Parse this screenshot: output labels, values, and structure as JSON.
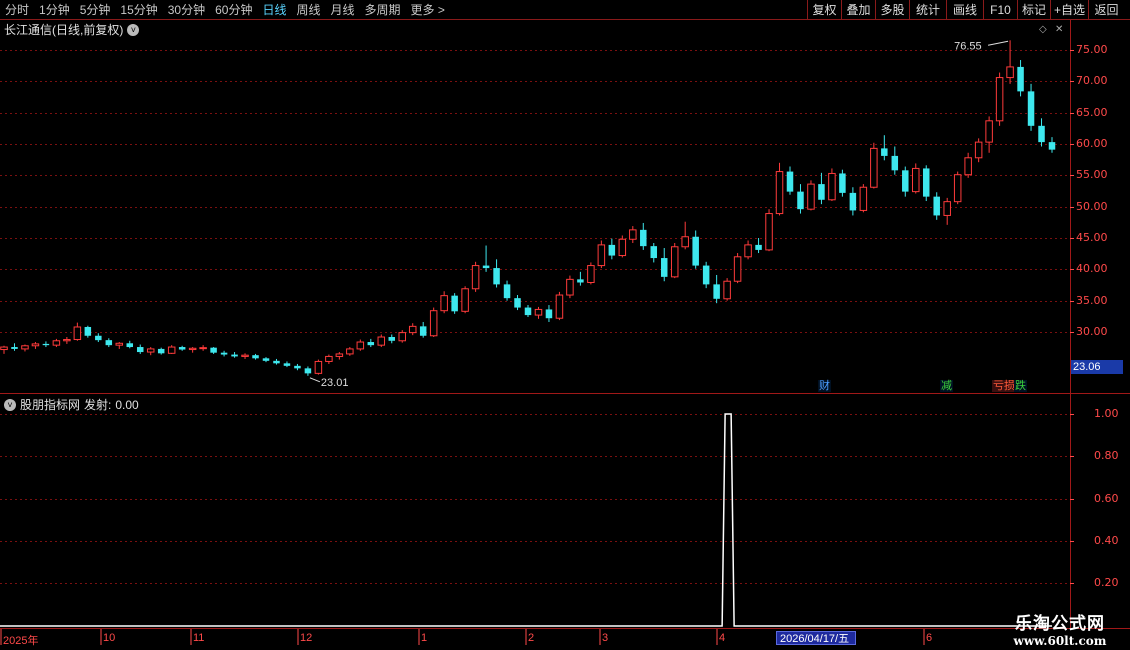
{
  "periods": [
    "分时",
    "1分钟",
    "5分钟",
    "15分钟",
    "30分钟",
    "60分钟",
    "日线",
    "周线",
    "月线",
    "多周期",
    "更多 >"
  ],
  "active_period": "日线",
  "tools": [
    "复权",
    "叠加",
    "多股",
    "统计",
    "画线",
    "F10",
    "标记",
    "+自选",
    "返回"
  ],
  "stock_title": "长江通信(日线,前复权)",
  "indicator_title": "股朋指标网",
  "indicator_signal_label": "发射:",
  "indicator_signal_value": "0.00",
  "price_axis": [
    "75.00",
    "70.00",
    "65.00",
    "60.00",
    "55.00",
    "50.00",
    "45.00",
    "40.00",
    "35.00",
    "30.00"
  ],
  "indicator_axis": [
    "1.00",
    "0.80",
    "0.60",
    "0.40",
    "0.20"
  ],
  "current_price": "23.06",
  "high_label": "76.55",
  "low_label": "23.01",
  "time_axis": [
    "2025年",
    "10",
    "11",
    "12",
    "1",
    "2",
    "3",
    "4",
    "2026/04/17/五",
    "6"
  ],
  "markers": [
    {
      "text": "财",
      "color": "#4a9cff"
    },
    {
      "text": "减",
      "color": "#3cd33c"
    },
    {
      "text": "亏损",
      "color": "#ff5a3a"
    },
    {
      "text": "跌",
      "color": "#3cd33c"
    }
  ],
  "watermark": {
    "line1": "乐淘公式网",
    "line2": "www.60lt.com"
  },
  "colors": {
    "up": "#ff3b3b",
    "down": "#3ee8ee",
    "grid": "#7a1010",
    "axis": "#ff4a4a",
    "signal": "#ffffff"
  },
  "chart_data": {
    "type": "candlestick",
    "ylim": [
      23,
      77
    ],
    "candles": [
      [
        27.2,
        27.8,
        26.5,
        27.6
      ],
      [
        27.6,
        28.2,
        27.0,
        27.3
      ],
      [
        27.3,
        28.0,
        26.9,
        27.8
      ],
      [
        27.8,
        28.4,
        27.3,
        28.1
      ],
      [
        28.1,
        28.5,
        27.6,
        27.9
      ],
      [
        27.9,
        28.9,
        27.6,
        28.6
      ],
      [
        28.6,
        29.2,
        28.1,
        28.8
      ],
      [
        28.8,
        31.5,
        28.6,
        30.8
      ],
      [
        30.8,
        31.0,
        29.1,
        29.4
      ],
      [
        29.4,
        29.8,
        28.4,
        28.7
      ],
      [
        28.7,
        29.0,
        27.6,
        27.9
      ],
      [
        27.9,
        28.4,
        27.3,
        28.2
      ],
      [
        28.2,
        28.6,
        27.4,
        27.6
      ],
      [
        27.6,
        28.0,
        26.5,
        26.8
      ],
      [
        26.8,
        27.6,
        26.3,
        27.3
      ],
      [
        27.3,
        27.5,
        26.4,
        26.6
      ],
      [
        26.6,
        27.9,
        26.5,
        27.6
      ],
      [
        27.6,
        27.8,
        27.0,
        27.2
      ],
      [
        27.2,
        27.6,
        26.7,
        27.4
      ],
      [
        27.4,
        27.9,
        27.0,
        27.5
      ],
      [
        27.5,
        27.6,
        26.5,
        26.7
      ],
      [
        26.7,
        27.0,
        26.1,
        26.4
      ],
      [
        26.4,
        26.8,
        25.9,
        26.1
      ],
      [
        26.1,
        26.6,
        25.7,
        26.3
      ],
      [
        26.3,
        26.5,
        25.6,
        25.8
      ],
      [
        25.8,
        26.0,
        25.2,
        25.4
      ],
      [
        25.4,
        25.7,
        24.8,
        25.0
      ],
      [
        25.0,
        25.3,
        24.4,
        24.6
      ],
      [
        24.6,
        24.9,
        23.9,
        24.2
      ],
      [
        24.2,
        24.5,
        23.01,
        23.4
      ],
      [
        23.4,
        25.6,
        23.2,
        25.3
      ],
      [
        25.3,
        26.4,
        24.9,
        26.1
      ],
      [
        26.1,
        26.8,
        25.6,
        26.5
      ],
      [
        26.5,
        27.6,
        26.2,
        27.3
      ],
      [
        27.3,
        28.8,
        27.0,
        28.4
      ],
      [
        28.4,
        28.9,
        27.6,
        27.9
      ],
      [
        27.9,
        29.6,
        27.6,
        29.2
      ],
      [
        29.2,
        29.6,
        28.2,
        28.6
      ],
      [
        28.6,
        30.3,
        28.3,
        29.9
      ],
      [
        29.9,
        31.4,
        29.5,
        30.9
      ],
      [
        30.9,
        31.6,
        29.1,
        29.4
      ],
      [
        29.4,
        33.9,
        29.2,
        33.4
      ],
      [
        33.4,
        36.5,
        33.0,
        35.8
      ],
      [
        35.8,
        36.2,
        32.9,
        33.3
      ],
      [
        33.3,
        37.3,
        33.0,
        36.9
      ],
      [
        36.9,
        41.2,
        36.4,
        40.6
      ],
      [
        40.6,
        43.8,
        39.6,
        40.2
      ],
      [
        40.2,
        41.6,
        37.1,
        37.6
      ],
      [
        37.6,
        38.2,
        35.0,
        35.4
      ],
      [
        35.4,
        35.9,
        33.5,
        33.9
      ],
      [
        33.9,
        34.3,
        32.4,
        32.7
      ],
      [
        32.7,
        34.0,
        32.1,
        33.6
      ],
      [
        33.6,
        34.3,
        31.6,
        32.2
      ],
      [
        32.2,
        36.4,
        31.9,
        35.9
      ],
      [
        35.9,
        39.0,
        35.4,
        38.4
      ],
      [
        38.4,
        39.6,
        37.4,
        37.9
      ],
      [
        37.9,
        41.1,
        37.6,
        40.6
      ],
      [
        40.6,
        44.6,
        40.2,
        43.9
      ],
      [
        43.9,
        44.9,
        41.6,
        42.2
      ],
      [
        42.2,
        45.4,
        41.9,
        44.8
      ],
      [
        44.8,
        46.9,
        44.2,
        46.3
      ],
      [
        46.3,
        47.4,
        43.1,
        43.7
      ],
      [
        43.7,
        44.2,
        41.1,
        41.8
      ],
      [
        41.8,
        43.4,
        38.1,
        38.8
      ],
      [
        38.8,
        44.2,
        38.6,
        43.6
      ],
      [
        43.6,
        47.6,
        43.2,
        45.2
      ],
      [
        45.2,
        46.2,
        40.1,
        40.6
      ],
      [
        40.6,
        41.2,
        37.0,
        37.6
      ],
      [
        37.6,
        39.1,
        34.6,
        35.3
      ],
      [
        35.3,
        38.6,
        35.0,
        38.1
      ],
      [
        38.1,
        42.6,
        37.8,
        42.0
      ],
      [
        42.0,
        44.6,
        41.6,
        43.9
      ],
      [
        43.9,
        45.0,
        42.6,
        43.1
      ],
      [
        43.1,
        49.6,
        42.9,
        48.9
      ],
      [
        48.9,
        57.0,
        48.6,
        55.6
      ],
      [
        55.6,
        56.4,
        51.9,
        52.4
      ],
      [
        52.4,
        53.6,
        48.9,
        49.6
      ],
      [
        49.6,
        54.2,
        49.4,
        53.6
      ],
      [
        53.6,
        55.4,
        50.4,
        51.1
      ],
      [
        51.1,
        56.1,
        50.9,
        55.3
      ],
      [
        55.3,
        55.9,
        51.6,
        52.2
      ],
      [
        52.2,
        53.1,
        48.6,
        49.4
      ],
      [
        49.4,
        53.6,
        49.1,
        53.1
      ],
      [
        53.1,
        60.2,
        52.9,
        59.3
      ],
      [
        59.3,
        61.4,
        57.4,
        58.1
      ],
      [
        58.1,
        59.6,
        55.1,
        55.8
      ],
      [
        55.8,
        56.4,
        51.6,
        52.4
      ],
      [
        52.4,
        56.9,
        52.1,
        56.1
      ],
      [
        56.1,
        56.6,
        50.9,
        51.6
      ],
      [
        51.6,
        52.3,
        47.9,
        48.6
      ],
      [
        48.6,
        51.4,
        47.1,
        50.8
      ],
      [
        50.8,
        55.6,
        50.4,
        55.1
      ],
      [
        55.1,
        58.6,
        54.6,
        57.8
      ],
      [
        57.8,
        60.9,
        57.1,
        60.3
      ],
      [
        60.3,
        64.4,
        58.6,
        63.7
      ],
      [
        63.7,
        71.4,
        62.9,
        70.6
      ],
      [
        70.6,
        76.55,
        69.6,
        72.3
      ],
      [
        72.3,
        73.4,
        67.6,
        68.4
      ],
      [
        68.4,
        69.6,
        62.1,
        62.9
      ],
      [
        62.9,
        64.1,
        59.6,
        60.3
      ],
      [
        60.3,
        61.1,
        58.6,
        59.1
      ]
    ],
    "indicator": {
      "name": "发射",
      "values_note": "pulse",
      "pulse_index": 69,
      "pulse_value": 1.0,
      "ylim": [
        0,
        1.05
      ]
    }
  }
}
